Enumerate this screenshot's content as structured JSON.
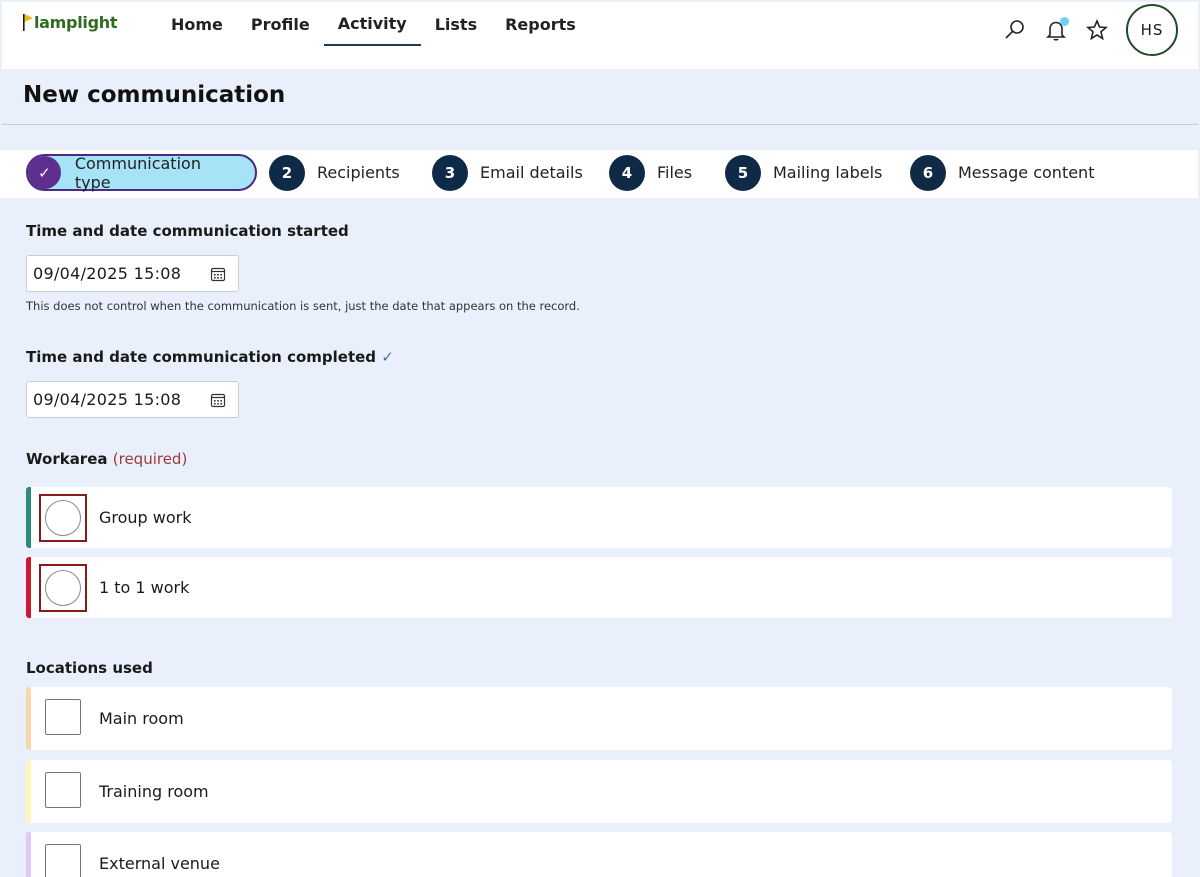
{
  "brand": {
    "name": "lamplight"
  },
  "nav": {
    "items": [
      "Home",
      "Profile",
      "Activity",
      "Lists",
      "Reports"
    ],
    "active": "Activity"
  },
  "user": {
    "initials": "HS"
  },
  "page": {
    "title": "New communication"
  },
  "steps": [
    {
      "marker": "✓",
      "label": "Communication type",
      "current": true
    },
    {
      "marker": "2",
      "label": "Recipients"
    },
    {
      "marker": "3",
      "label": "Email details"
    },
    {
      "marker": "4",
      "label": "Files"
    },
    {
      "marker": "5",
      "label": "Mailing labels"
    },
    {
      "marker": "6",
      "label": "Message content"
    }
  ],
  "started": {
    "label": "Time and date communication started",
    "value": "09/04/2025 15:08",
    "hint": "This does not control when the communication is sent, just the date that appears on the record."
  },
  "completed": {
    "label": "Time and date communication completed",
    "tick": "✓",
    "value": "09/04/2025 15:08"
  },
  "workarea": {
    "label": "Workarea",
    "required": "(required)",
    "options": [
      {
        "label": "Group work",
        "color": "#2e8b7a"
      },
      {
        "label": "1 to 1 work",
        "color": "#d0182f"
      }
    ]
  },
  "locations": {
    "label": "Locations used",
    "options": [
      {
        "label": "Main room",
        "color": "#fbd5b0"
      },
      {
        "label": "Training room",
        "color": "#fff7b8"
      },
      {
        "label": "External venue",
        "color": "#e6c6f7"
      }
    ]
  }
}
